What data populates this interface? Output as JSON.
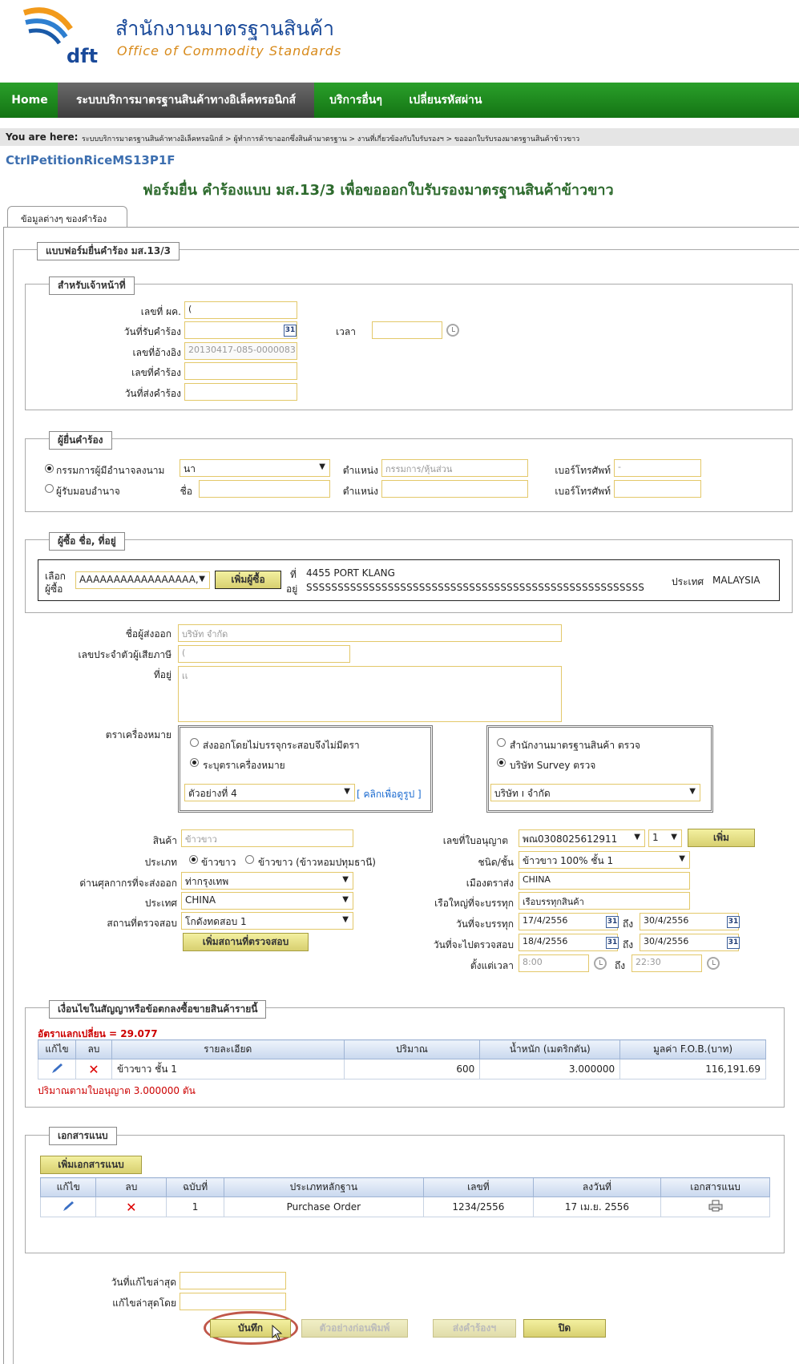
{
  "header": {
    "title_th": "สำนักงานมาตรฐานสินค้า",
    "title_en": "Office of Commodity Standards",
    "logo_text": "dft"
  },
  "nav": [
    "Home",
    "ระบบบริการมาตรฐานสินค้าทางอิเล็คทรอนิกส์",
    "บริการอื่นๆ",
    "เปลี่ยนรหัสผ่าน"
  ],
  "breadcrumb": {
    "label": "You are here:",
    "path": "ระบบบริการมาตรฐานสินค้าทางอิเล็คทรอนิกส์ > ผู้ทำการค้าขาออกซึ่งสินค้ามาตรฐาน > งานที่เกี่ยวข้องกับใบรับรองฯ > ขอออกใบรับรองมาตรฐานสินค้าข้าวขาว"
  },
  "page_id": "CtrlPetitionRiceMS13P1F",
  "form_title": "ฟอร์มยื่น คำร้องแบบ มส.13/3 เพื่อขอออกใบรับรองมาตรฐานสินค้าข้าวขาว",
  "tab": "ข้อมูลต่างๆ ของคำร้อง",
  "outer_legend": "แบบฟอร์มยื่นคำร้อง มส.13/3",
  "officer": {
    "legend": "สำหรับเจ้าหน้าที่",
    "l_no": "เลขที่ ผค.",
    "v_no": "(",
    "l_date": "วันที่รับคำร้อง",
    "l_time": "เวลา",
    "l_ref": "เลขที่อ้างอิง",
    "v_ref": "20130417-085-0000083",
    "l_reqno": "เลขที่คำร้อง",
    "l_send": "วันที่ส่งคำร้อง",
    "cal": "31"
  },
  "applicant": {
    "legend": "ผู้ยื่นคำร้อง",
    "r1": "กรรมการผู้มีอำนาจลงนาม",
    "r1_value": "นา",
    "pos": "ตำแหน่ง",
    "pos_value": "กรรมการ/หุ้นส่วน",
    "phone": "เบอร์โทรศัพท์",
    "phone_value": "-",
    "r2": "ผู้รับมอบอำนาจ",
    "name": "ชื่อ"
  },
  "buyer": {
    "legend": "ผู้ซื้อ ชื่อ, ที่อยู่",
    "select_label1": "เลือก",
    "select_label2": "ผู้ซื้อ",
    "select_value": "AAAAAAAAAAAAAAAAA,",
    "add_btn": "เพิ่มผู้ซื้อ",
    "addr_label1": "ที่",
    "addr_label2": "อยู่",
    "addr1": "4455 PORT KLANG",
    "addr2": "SSSSSSSSSSSSSSSSSSSSSSSSSSSSSSSSSSSSSSSSSSSSSSSSSSSSSS",
    "country_label": "ประเทศ",
    "country": "MALAYSIA"
  },
  "exporter": {
    "l_name": "ชื่อผู้ส่งออก",
    "v_name": "บริษัท                    จำกัด",
    "l_tax": "เลขประจำตัวผู้เสียภาษี",
    "v_tax": "(",
    "l_addr": "ที่อยู่",
    "v_addr": "เเ"
  },
  "mark": {
    "label": "ตราเครื่องหมาย",
    "opt1": "ส่งออกโดยไม่บรรจุกระสอบจึงไม่มีตรา",
    "opt2": "ระบุตราเครื่องหมาย",
    "sample": "ตัวอย่างที่ 4",
    "view": "[ คลิกเพื่อดูรูป ]",
    "insp1": "สำนักงานมาตรฐานสินค้า ตรวจ",
    "insp2": "บริษัท Survey ตรวจ",
    "company": "บริษัท                         ı จำกัด"
  },
  "goods": {
    "l_product": "สินค้า",
    "v_product": "ข้าวขาว",
    "l_type": "ประเภท",
    "t1": "ข้าวขาว",
    "t2": "ข้าวขาว (ข้าวหอมปทุมธานี)",
    "l_customs": "ด่านศุลกากรที่จะส่งออก",
    "v_customs": "ท่ากรุงเทพ",
    "l_country": "ประเทศ",
    "v_country": "CHINA",
    "l_place": "สถานที่ตรวจสอบ",
    "v_place": "โกดังทดสอบ 1",
    "add_place": "เพิ่มสถานที่ตรวจสอบ",
    "l_permit": "เลขที่ใบอนุญาต",
    "v_permit": "พณ0308025612911",
    "v_permit_no": "1",
    "add": "เพิ่ม",
    "l_grade": "ชนิด/ชั้น",
    "v_grade": "ข้าวขาว 100% ชั้น 1",
    "l_port": "เมืองตราส่ง",
    "v_port": "CHINA",
    "l_ship": "เรือใหญ่ที่จะบรรทุก",
    "v_ship": "เรือบรรทุกสินค้า",
    "l_load": "วันที่จะบรรทุก",
    "load_from": "17/4/2556",
    "to": "ถึง",
    "load_to": "30/4/2556",
    "l_insp": "วันที่จะไปตรวจสอบ",
    "insp_from": "18/4/2556",
    "insp_to": "30/4/2556",
    "l_time": "ตั้งแต่เวลา",
    "time_from": "8:00",
    "time_to": "22:30"
  },
  "contract": {
    "legend": "เงื่อนไขในสัญญาหรือข้อตกลงซื้อขายสินค้ารายนี้",
    "rate": "อัตราแลกเปลี่ยน = 29.077",
    "headers": [
      "แก้ไข",
      "ลบ",
      "รายละเอียด",
      "ปริมาณ",
      "น้ำหนัก (เมตริกตัน)",
      "มูลค่า F.O.B.(บาท)"
    ],
    "rows": [
      {
        "detail": "ข้าวขาว ชั้น 1",
        "qty": "600",
        "weight": "3.000000",
        "fob": "116,191.69"
      }
    ],
    "note": "ปริมาณตามใบอนุญาต 3.000000 ตัน"
  },
  "attach": {
    "legend": "เอกสารแนบ",
    "add_btn": "เพิ่มเอกสารแนบ",
    "headers": [
      "แก้ไข",
      "ลบ",
      "ฉบับที่",
      "ประเภทหลักฐาน",
      "เลขที่",
      "ลงวันที่",
      "เอกสารแนบ"
    ],
    "rows": [
      {
        "no": "1",
        "type": "Purchase Order",
        "num": "1234/2556",
        "date": "17 เม.ย. 2556"
      }
    ]
  },
  "footer": {
    "l_modified": "วันที่แก้ไขล่าสุด",
    "l_by": "แก้ไขล่าสุดโดย",
    "save": "บันทึก",
    "preview": "ตัวอย่างก่อนพิมพ์",
    "submit": "ส่งคำร้องฯ",
    "close": "ปิด"
  },
  "colors": {
    "nav_green": "#1e8a1e",
    "nav_dark": "#4a4a4a",
    "title_green": "#2e6b2e",
    "link_blue": "#3d6fb0"
  }
}
